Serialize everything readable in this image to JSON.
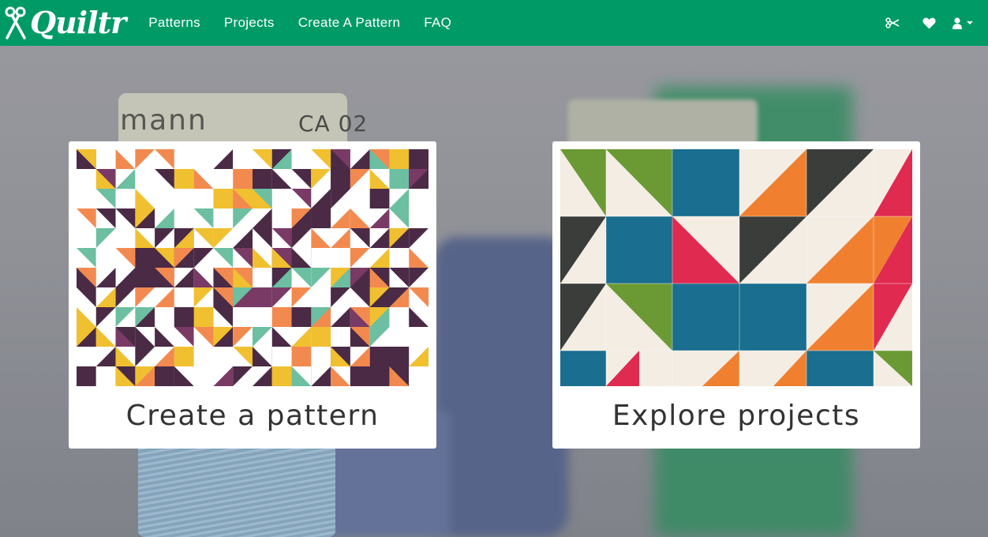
{
  "brand": {
    "name": "Quiltr",
    "icon": "scissors-icon"
  },
  "nav": {
    "links": [
      {
        "label": "Patterns"
      },
      {
        "label": "Projects"
      },
      {
        "label": "Create A Pattern"
      },
      {
        "label": "FAQ"
      }
    ],
    "right_icons": [
      "scissors-icon",
      "heart-icon",
      "user-icon",
      "caret-down-icon"
    ]
  },
  "background": {
    "spool_label_1": "mann",
    "spool_label_2": "CA 02"
  },
  "cards": [
    {
      "title": "Create a pattern",
      "image": "geometric-quilt-pattern"
    },
    {
      "title": "Explore projects",
      "image": "quilt-photo"
    }
  ],
  "colors": {
    "navbar": "#009a66",
    "pattern_palette": [
      "#4a2a45",
      "#6cbfa0",
      "#f0c030",
      "#f28a50",
      "#7a3a66",
      "#ffffff"
    ],
    "quilt_palette": [
      "#1a6e8f",
      "#e02a50",
      "#f08030",
      "#6b9a34",
      "#3a3d3a",
      "#f3ede4"
    ]
  }
}
